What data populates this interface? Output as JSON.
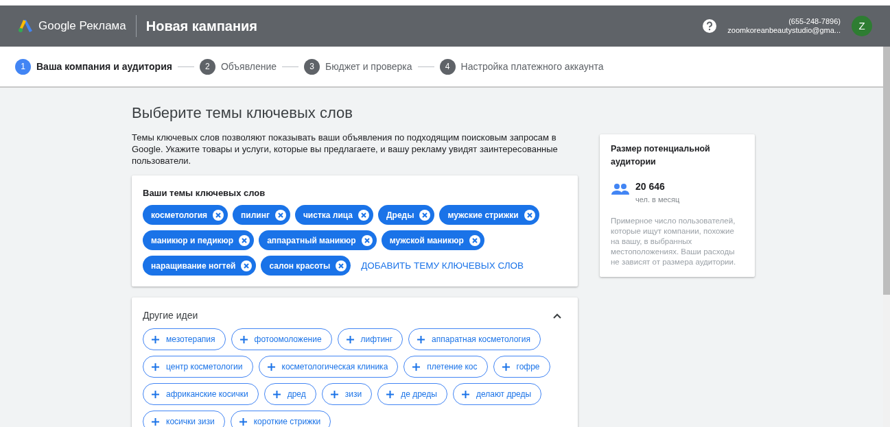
{
  "header": {
    "product": "Google Реклама",
    "title": "Новая кампания",
    "phone": "(655-248-7896)",
    "email": "zoomkoreanbeautystudio@gma...",
    "avatar": "Z"
  },
  "steps": [
    {
      "number": "1",
      "label": "Ваша компания и аудитория",
      "selected": true
    },
    {
      "number": "2",
      "label": "Объявление",
      "selected": false
    },
    {
      "number": "3",
      "label": "Бюджет и проверка",
      "selected": false
    },
    {
      "number": "4",
      "label": "Настройка платежного аккаунта",
      "selected": false
    }
  ],
  "heading": "Выберите темы ключевых слов",
  "description": "Темы ключевых слов позволяют показывать ваши объявления по подходящим поисковым запросам в Google. Укажите товары и услуги, которые вы предлагаете, и вашу рекламу увидят заинтересованные пользователи.",
  "keywords": {
    "title": "Ваши темы ключевых слов",
    "chips": [
      "косметология",
      "пилинг",
      "чистка лица",
      "Дреды",
      "мужские стрижки",
      "маникюр и педикюр",
      "аппаратный маникюр",
      "мужской маникюр",
      "наращивание ногтей",
      "салон красоты"
    ],
    "add_link": "ДОБАВИТЬ ТЕМУ КЛЮЧЕВЫХ СЛОВ"
  },
  "ideas": {
    "title": "Другие идеи",
    "expanded": true,
    "chips": [
      "мезотерапия",
      "фотоомоложение",
      "лифтинг",
      "аппаратная косметология",
      "центр косметологии",
      "косметологическая клиника",
      "плетение кос",
      "гофре",
      "африканские косички",
      "дред",
      "зизи",
      "де дреды",
      "делают дреды",
      "косички зизи",
      "короткие стрижки"
    ]
  },
  "audience": {
    "title": "Размер потенциальной аудитории",
    "count": "20 646",
    "unit": "чел. в месяц",
    "note": "Примерное число пользователей, которые ищут компании, похожие на вашу, в выбранных местоположениях. Ваши расходы не зависят от размера аудитории."
  }
}
